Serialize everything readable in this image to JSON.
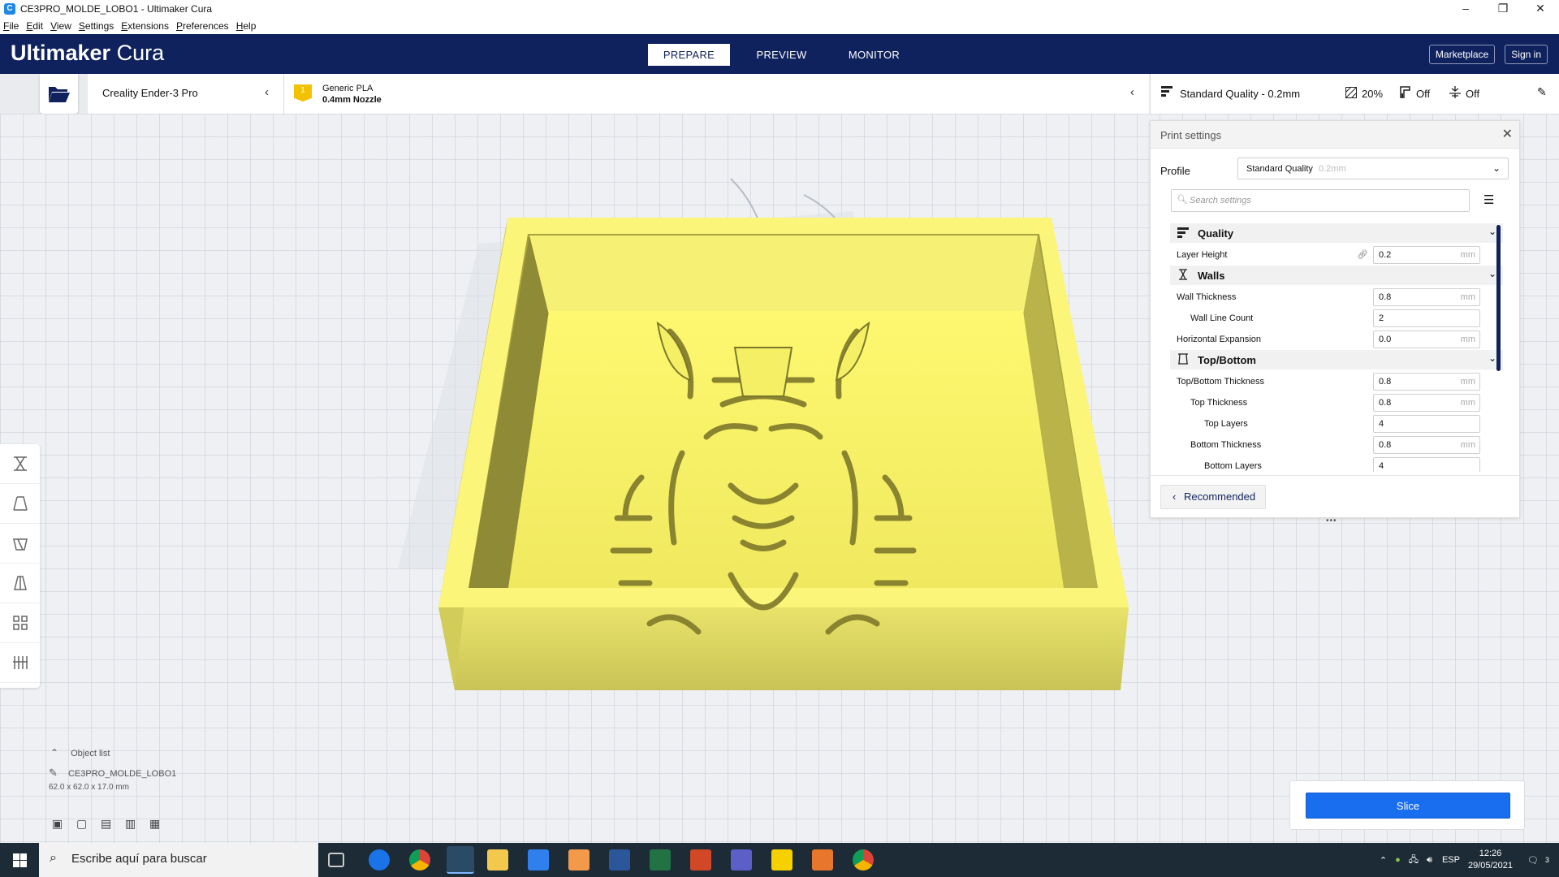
{
  "window": {
    "title": "CE3PRO_MOLDE_LOBO1 - Ultimaker Cura",
    "app_icon": "C"
  },
  "menu": [
    "File",
    "Edit",
    "View",
    "Settings",
    "Extensions",
    "Preferences",
    "Help"
  ],
  "header": {
    "logo_bold": "Ultimaker",
    "logo_light": "Cura",
    "tabs": [
      "PREPARE",
      "PREVIEW",
      "MONITOR"
    ],
    "active_tab": "PREPARE",
    "marketplace": "Marketplace",
    "signin": "Sign in"
  },
  "toolbar": {
    "printer": "Creality Ender-3 Pro",
    "extruder_badge": "1",
    "material": "Generic PLA",
    "nozzle": "0.4mm Nozzle",
    "quality_summary": "Standard Quality - 0.2mm",
    "infill": "20%",
    "support": "Off",
    "adhesion": "Off"
  },
  "panel": {
    "title": "Print settings",
    "profile_label": "Profile",
    "profile_value": "Standard Quality",
    "profile_sub": "0.2mm",
    "search_placeholder": "Search settings",
    "recommended": "Recommended",
    "categories": {
      "quality": "Quality",
      "walls": "Walls",
      "topbottom": "Top/Bottom"
    },
    "settings": {
      "layer_height": {
        "label": "Layer Height",
        "value": "0.2",
        "unit": "mm"
      },
      "wall_thickness": {
        "label": "Wall Thickness",
        "value": "0.8",
        "unit": "mm"
      },
      "wall_line_count": {
        "label": "Wall Line Count",
        "value": "2"
      },
      "horizontal_expansion": {
        "label": "Horizontal Expansion",
        "value": "0.0",
        "unit": "mm"
      },
      "topbottom_thickness": {
        "label": "Top/Bottom Thickness",
        "value": "0.8",
        "unit": "mm"
      },
      "top_thickness": {
        "label": "Top Thickness",
        "value": "0.8",
        "unit": "mm"
      },
      "top_layers": {
        "label": "Top Layers",
        "value": "4"
      },
      "bottom_thickness": {
        "label": "Bottom Thickness",
        "value": "0.8",
        "unit": "mm"
      },
      "bottom_layers": {
        "label": "Bottom Layers",
        "value": "4"
      }
    }
  },
  "objects": {
    "header": "Object list",
    "name": "CE3PRO_MOLDE_LOBO1",
    "dimensions": "62.0 x 62.0 x 17.0 mm"
  },
  "slice_label": "Slice",
  "taskbar": {
    "search_placeholder": "Escribe aquí para buscar",
    "lang": "ESP",
    "time": "12:26",
    "date": "29/05/2021",
    "notif_count": "3"
  },
  "colors": {
    "header": "#10225e",
    "accent": "#196ef0",
    "model_top": "#fbf57a",
    "model_side": "#d9d35a",
    "badge": "#f2c200"
  }
}
